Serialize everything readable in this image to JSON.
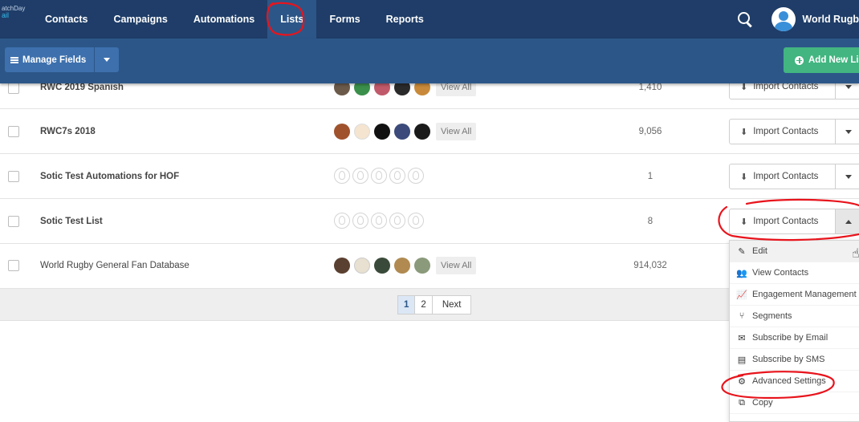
{
  "app": {
    "logo_line1": "atchDay",
    "logo_line2": "ail",
    "org_name": "World Rugb"
  },
  "nav": {
    "items": [
      {
        "label": "Contacts"
      },
      {
        "label": "Campaigns"
      },
      {
        "label": "Automations"
      },
      {
        "label": "Lists",
        "active": true
      },
      {
        "label": "Forms"
      },
      {
        "label": "Reports"
      }
    ]
  },
  "toolbar": {
    "manage_fields_label": "Manage Fields",
    "add_new_list_label": "Add New Lis"
  },
  "rows": [
    {
      "name": "RWC 2019 Spanish",
      "count": "1,410",
      "view_all": "View All",
      "import_label": "Import Contacts",
      "has_avatars": true
    },
    {
      "name": "RWC7s 2018",
      "count": "9,056",
      "view_all": "View All",
      "import_label": "Import Contacts",
      "has_avatars": true
    },
    {
      "name": "Sotic Test Automations for HOF",
      "count": "1",
      "import_label": "Import Contacts",
      "has_avatars": false
    },
    {
      "name": "Sotic Test List",
      "count": "8",
      "import_label": "Import Contacts",
      "has_avatars": false
    },
    {
      "name": "World Rugby General Fan Database",
      "count": "914,032",
      "view_all": "View All",
      "import_label": "Import Contacts",
      "has_avatars": true
    }
  ],
  "pagination": {
    "pages": [
      "1",
      "2"
    ],
    "current": "1",
    "next_label": "Next"
  },
  "dropdown": {
    "items": [
      {
        "label": "Edit",
        "icon": "pencil-icon"
      },
      {
        "label": "View Contacts",
        "icon": "users-icon"
      },
      {
        "label": "Engagement Management",
        "icon": "chart-line-icon"
      },
      {
        "label": "Segments",
        "icon": "branch-icon"
      },
      {
        "label": "Subscribe by Email",
        "icon": "envelope-icon"
      },
      {
        "label": "Subscribe by SMS",
        "icon": "sms-icon"
      },
      {
        "label": "Advanced Settings",
        "icon": "gear-icon"
      },
      {
        "label": "Copy",
        "icon": "copy-icon"
      }
    ]
  },
  "colors": {
    "nav_bg": "#1f3d68",
    "toolbar_bg": "#2c5688",
    "add_button": "#42b580",
    "annotation": "#e8141c"
  }
}
